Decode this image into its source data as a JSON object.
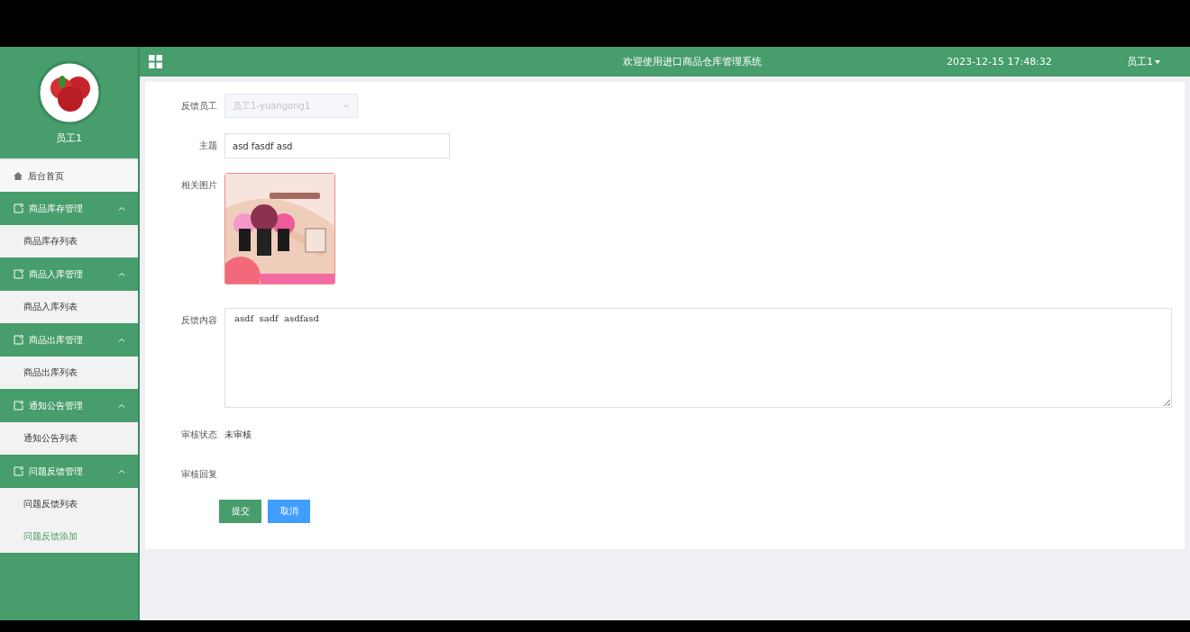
{
  "header": {
    "title": "欢迎使用进口商品仓库管理系统",
    "datetime": "2023-12-15 17:48:32",
    "user": "员工1"
  },
  "sidebar": {
    "username": "员工1",
    "items": [
      {
        "label": "后台首页",
        "kind": "link",
        "selected": false
      },
      {
        "label": "商品库存管理",
        "kind": "group",
        "expanded": true,
        "children": [
          {
            "label": "商品库存列表",
            "selected": false
          }
        ]
      },
      {
        "label": "商品入库管理",
        "kind": "group",
        "expanded": true,
        "children": [
          {
            "label": "商品入库列表",
            "selected": false
          }
        ]
      },
      {
        "label": "商品出库管理",
        "kind": "group",
        "expanded": true,
        "children": [
          {
            "label": "商品出库列表",
            "selected": false
          }
        ]
      },
      {
        "label": "通知公告管理",
        "kind": "group",
        "expanded": true,
        "children": [
          {
            "label": "通知公告列表",
            "selected": false
          }
        ]
      },
      {
        "label": "问题反馈管理",
        "kind": "group",
        "expanded": true,
        "children": [
          {
            "label": "问题反馈列表",
            "selected": false
          },
          {
            "label": "问题反馈添加",
            "selected": true
          }
        ]
      }
    ]
  },
  "form": {
    "fields": [
      {
        "label": "反馈员工",
        "kind": "select",
        "value": "员工1-yuangong1",
        "disabled": true
      },
      {
        "label": "主题",
        "kind": "input",
        "value": "asd fasdf asd"
      },
      {
        "label": "相关图片"
      },
      {
        "label": "反馈内容",
        "kind": "textarea",
        "value": "asdf  sadf  asdfasd"
      },
      {
        "label": "审核状态",
        "kind": "text",
        "value": "未审核"
      },
      {
        "label": "审核回复",
        "kind": "text"
      }
    ],
    "buttons": [
      {
        "label": "提交",
        "kind": "primary"
      },
      {
        "label": "取消",
        "kind": "secondary"
      }
    ]
  }
}
